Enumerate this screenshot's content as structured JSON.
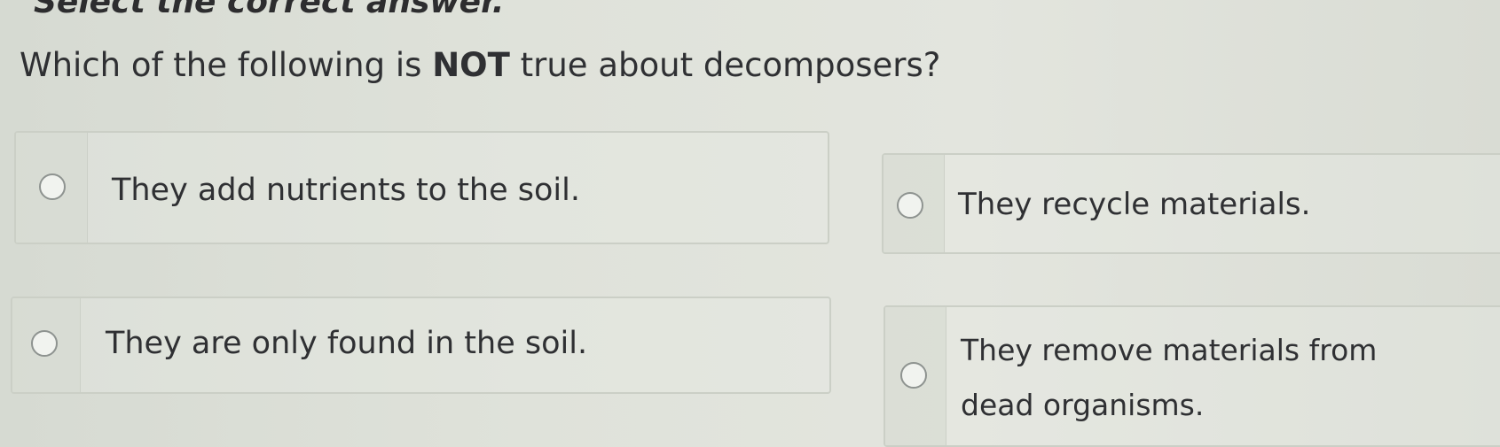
{
  "instruction": "Select the correct answer.",
  "question": {
    "before": "Which of the following is ",
    "emphasis": "NOT",
    "after": " true about decomposers?"
  },
  "choices": [
    {
      "text": "They add nutrients to the soil.",
      "selected": false
    },
    {
      "text": "They recycle materials.",
      "selected": false
    },
    {
      "text": "They are only found in the soil.",
      "selected": false
    },
    {
      "text": "They remove materials from dead organisms.",
      "selected": false
    }
  ]
}
